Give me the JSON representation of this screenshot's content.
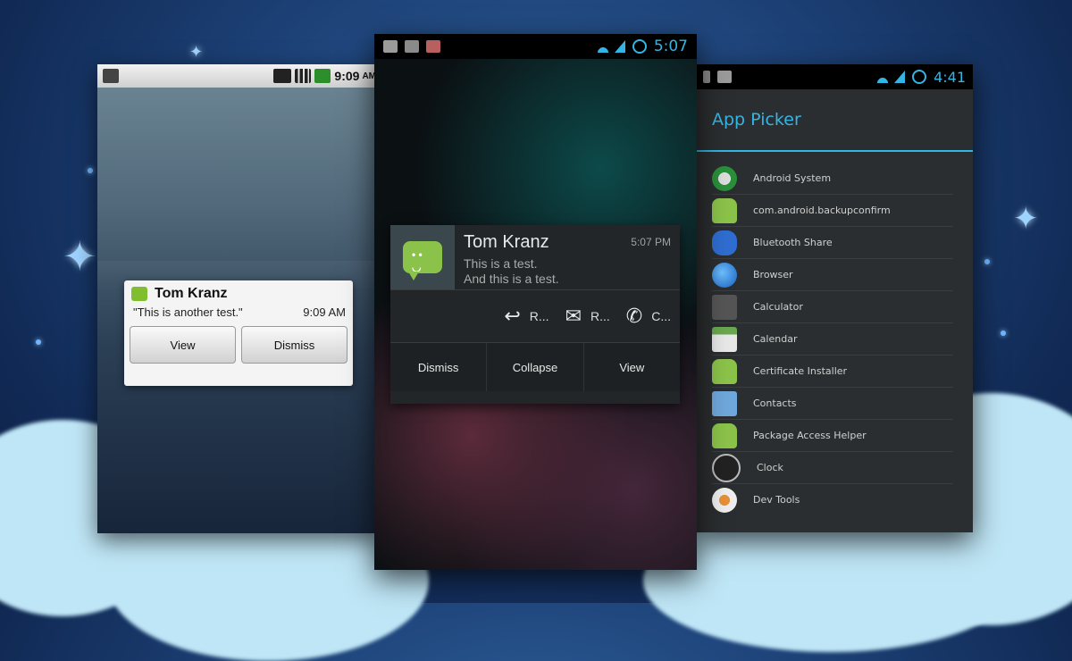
{
  "left_phone": {
    "status_time": "9:09",
    "status_ampm": "AM",
    "popup": {
      "sender": "Tom Kranz",
      "message": "\"This is another test.\"",
      "time": "9:09 AM",
      "view_label": "View",
      "dismiss_label": "Dismiss"
    }
  },
  "middle_phone": {
    "status_time": "5:07",
    "notification": {
      "sender": "Tom Kranz",
      "time": "5:07 PM",
      "line1": "This is a test.",
      "line2": "And this is a test.",
      "actions": [
        {
          "icon": "reply-icon",
          "label": "R..."
        },
        {
          "icon": "open-envelope-icon",
          "label": "R..."
        },
        {
          "icon": "phone-icon",
          "label": "C..."
        }
      ],
      "buttons": [
        "Dismiss",
        "Collapse",
        "View"
      ]
    }
  },
  "right_phone": {
    "status_time": "4:41",
    "title": "App Picker",
    "apps": [
      {
        "name": "Android System",
        "icon": "android-system-icon"
      },
      {
        "name": "com.android.backupconfirm",
        "icon": "android-droid-icon"
      },
      {
        "name": "Bluetooth Share",
        "icon": "bluetooth-icon"
      },
      {
        "name": "Browser",
        "icon": "globe-icon"
      },
      {
        "name": "Calculator",
        "icon": "calculator-icon"
      },
      {
        "name": "Calendar",
        "icon": "calendar-icon"
      },
      {
        "name": "Certificate Installer",
        "icon": "android-droid-icon"
      },
      {
        "name": "Contacts",
        "icon": "contacts-icon"
      },
      {
        "name": "Package Access Helper",
        "icon": "android-droid-icon"
      },
      {
        "name": "Clock",
        "icon": "clock-icon"
      },
      {
        "name": "Dev Tools",
        "icon": "gear-icon"
      }
    ]
  },
  "colors": {
    "holo_blue": "#33b5e5",
    "messaging_green": "#8bc34a"
  }
}
